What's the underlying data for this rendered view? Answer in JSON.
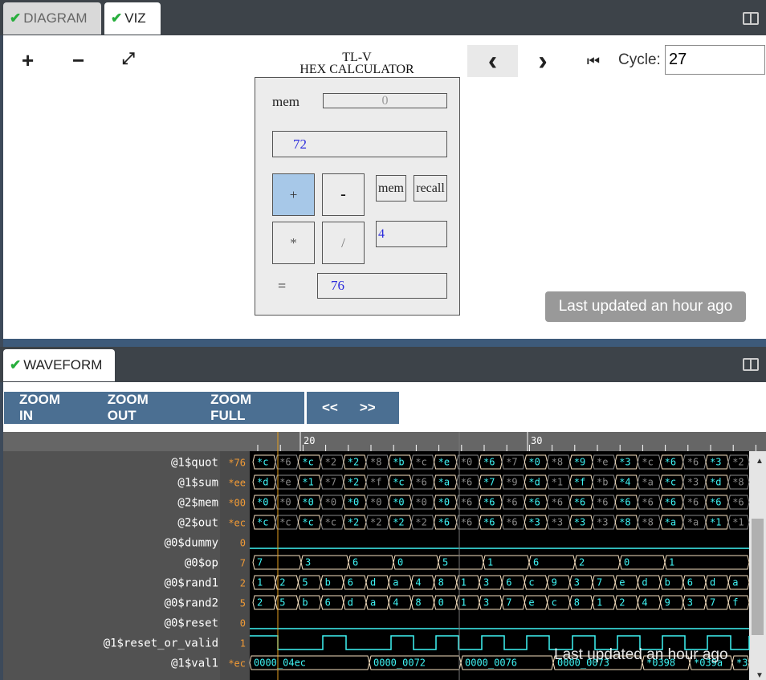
{
  "tabs": {
    "diagram": "DIAGRAM",
    "viz": "VIZ",
    "waveform": "WAVEFORM"
  },
  "viz": {
    "zoom_in_icon": "+",
    "zoom_out_icon": "−",
    "fit_icon": "⤢",
    "prev_icon": "‹",
    "next_icon": "›",
    "first_icon": "⏮",
    "cycle_label": "Cycle:",
    "cycle_value": "27",
    "updated_badge": "Last updated an hour ago",
    "calculator": {
      "title_line1": "TL-V",
      "title_line2": "HEX CALCULATOR",
      "mem_label": "mem",
      "mem_value": "0",
      "display_value": "72",
      "btn_plus": "+",
      "btn_minus": "-",
      "btn_mul": "*",
      "btn_div": "/",
      "btn_mem": "mem",
      "btn_recall": "recall",
      "operand_value": "4",
      "eq_label": "=",
      "result_value": "76"
    }
  },
  "waveform": {
    "buttons": {
      "zoom_in": "ZOOM IN",
      "zoom_out": "ZOOM OUT",
      "zoom_full": "ZOOM FULL",
      "back": "<<",
      "forward": ">>"
    },
    "timeline": [
      "20",
      "30"
    ],
    "updated_badge": "Last updated an hour ago",
    "signals": [
      {
        "name": "@1$quot",
        "value": "*76",
        "type": "bus",
        "cells": [
          "*c",
          "*6",
          "*c",
          "*2",
          "*2",
          "*8",
          "*b",
          "*c",
          "*e",
          "*0",
          "*6",
          "*7",
          "*0",
          "*8",
          "*9",
          "*e",
          "*3",
          "*c",
          "*6",
          "*6",
          "*3",
          "*2"
        ]
      },
      {
        "name": "@1$sum",
        "value": "*ee",
        "type": "bus",
        "cells": [
          "*d",
          "*e",
          "*1",
          "*7",
          "*2",
          "*f",
          "*c",
          "*6",
          "*a",
          "*6",
          "*7",
          "*9",
          "*d",
          "*1",
          "*f",
          "*b",
          "*4",
          "*a",
          "*c",
          "*3",
          "*d",
          "*8"
        ]
      },
      {
        "name": "@2$mem",
        "value": "*00",
        "type": "bus",
        "cells": [
          "*0",
          "*0",
          "*0",
          "*0",
          "*0",
          "*0",
          "*0",
          "*0",
          "*0",
          "*6",
          "*6",
          "*6",
          "*6",
          "*6",
          "*6",
          "*6",
          "*6",
          "*6",
          "*6",
          "*6",
          "*6",
          "*6"
        ]
      },
      {
        "name": "@2$out",
        "value": "*ec",
        "type": "bus",
        "cells": [
          "*c",
          "*c",
          "*c",
          "*c",
          "*2",
          "*2",
          "*2",
          "*2",
          "*6",
          "*6",
          "*6",
          "*6",
          "*3",
          "*3",
          "*3",
          "*3",
          "*8",
          "*8",
          "*a",
          "*a",
          "*1",
          "*1"
        ]
      },
      {
        "name": "@0$dummy",
        "value": "0",
        "type": "flat"
      },
      {
        "name": "@0$op",
        "value": "7",
        "type": "slow",
        "cells": [
          "7",
          "3",
          "6",
          "0",
          "5",
          "1",
          "6",
          "2",
          "0",
          "1"
        ]
      },
      {
        "name": "@0$rand1",
        "value": "2",
        "type": "fast",
        "cells": [
          "1",
          "2",
          "5",
          "b",
          "6",
          "d",
          "a",
          "4",
          "8",
          "1",
          "3",
          "6",
          "c",
          "9",
          "3",
          "7",
          "e",
          "d",
          "b",
          "6",
          "d",
          "a"
        ]
      },
      {
        "name": "@0$rand2",
        "value": "5",
        "type": "fast",
        "cells": [
          "2",
          "5",
          "b",
          "6",
          "d",
          "a",
          "4",
          "8",
          "0",
          "1",
          "3",
          "7",
          "e",
          "c",
          "8",
          "1",
          "2",
          "4",
          "9",
          "3",
          "7",
          "f"
        ]
      },
      {
        "name": "@0$reset",
        "value": "0",
        "type": "flat"
      },
      {
        "name": "@1$reset_or_valid",
        "value": "1",
        "type": "clock"
      },
      {
        "name": "@1$val1",
        "value": "*ec",
        "type": "wide",
        "cells": [
          "0000_04ec",
          "0000_0072",
          "0000_0076",
          "0000_0073",
          "*0398",
          "*039a",
          "*3"
        ]
      }
    ]
  },
  "colors": {
    "wave_active": "#3ff4f4",
    "wave_dim": "#8a8a8a",
    "cursor": "#e6a020",
    "badge": "#999999"
  }
}
